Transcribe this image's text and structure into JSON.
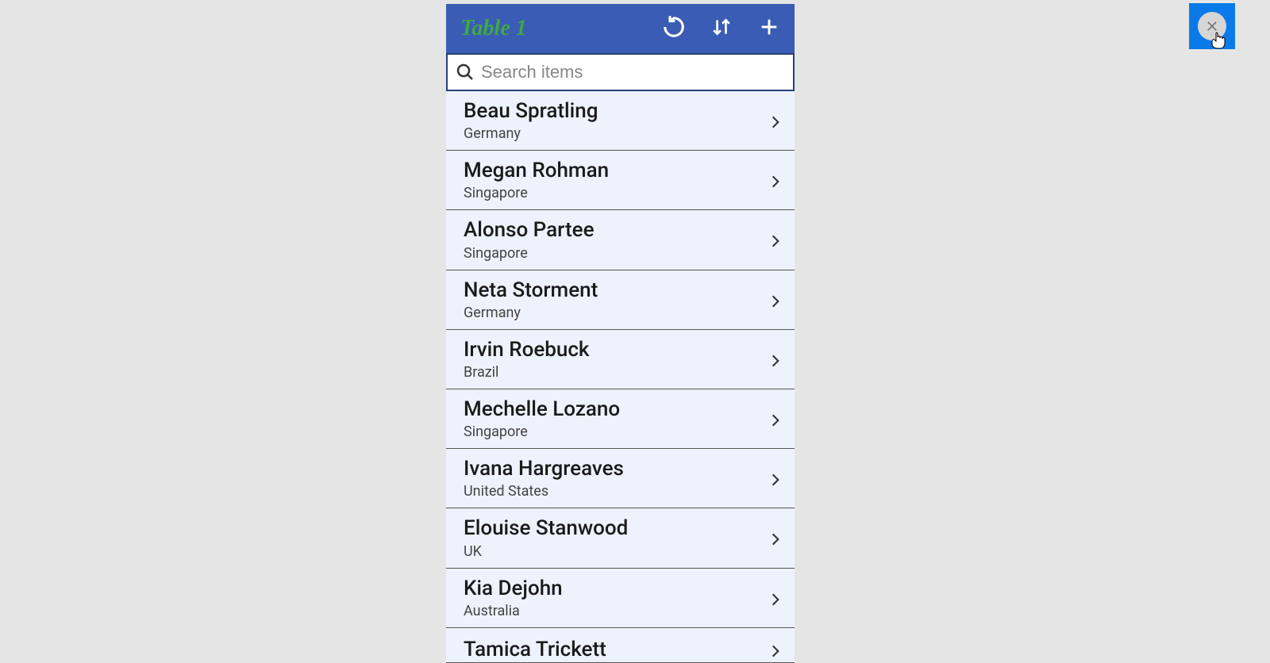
{
  "header": {
    "title": "Table 1"
  },
  "search": {
    "placeholder": "Search items"
  },
  "items": [
    {
      "name": "Beau Spratling",
      "country": "Germany"
    },
    {
      "name": "Megan Rohman",
      "country": "Singapore"
    },
    {
      "name": "Alonso Partee",
      "country": "Singapore"
    },
    {
      "name": "Neta Storment",
      "country": "Germany"
    },
    {
      "name": "Irvin Roebuck",
      "country": "Brazil"
    },
    {
      "name": "Mechelle Lozano",
      "country": "Singapore"
    },
    {
      "name": "Ivana Hargreaves",
      "country": "United States"
    },
    {
      "name": "Elouise Stanwood",
      "country": "UK"
    },
    {
      "name": "Kia Dejohn",
      "country": "Australia"
    },
    {
      "name": "Tamica Trickett",
      "country": ""
    }
  ]
}
